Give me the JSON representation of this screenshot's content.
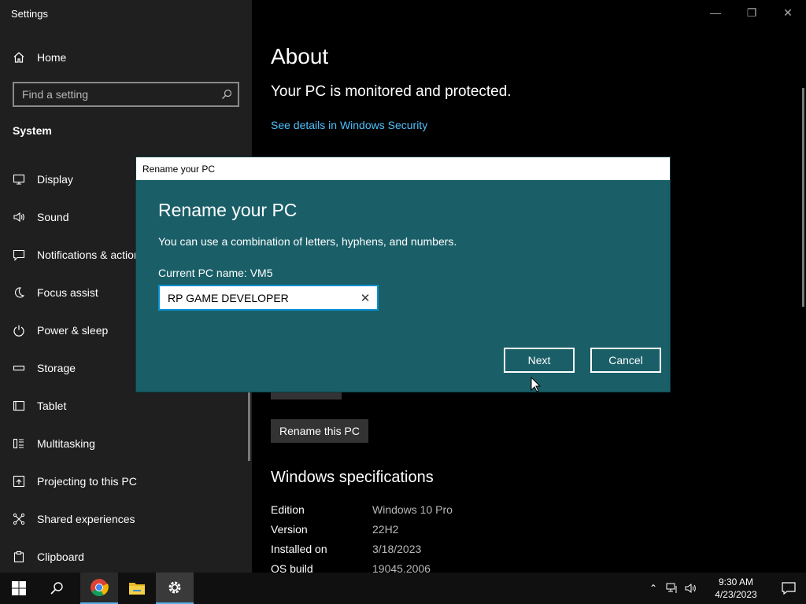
{
  "app": {
    "title": "Settings"
  },
  "sidebar": {
    "home_label": "Home",
    "search_placeholder": "Find a setting",
    "section_title": "System",
    "items": [
      {
        "label": "Display",
        "icon": "monitor-icon"
      },
      {
        "label": "Sound",
        "icon": "speaker-icon"
      },
      {
        "label": "Notifications & actions",
        "icon": "notification-icon"
      },
      {
        "label": "Focus assist",
        "icon": "moon-icon"
      },
      {
        "label": "Power & sleep",
        "icon": "power-icon"
      },
      {
        "label": "Storage",
        "icon": "storage-icon"
      },
      {
        "label": "Tablet",
        "icon": "tablet-icon"
      },
      {
        "label": "Multitasking",
        "icon": "multitasking-icon"
      },
      {
        "label": "Projecting to this PC",
        "icon": "projector-icon"
      },
      {
        "label": "Shared experiences",
        "icon": "shared-icon"
      },
      {
        "label": "Clipboard",
        "icon": "clipboard-icon"
      }
    ]
  },
  "main": {
    "title": "About",
    "protection_status": "Your PC is monitored and protected.",
    "security_link": "See details in Windows Security",
    "rename_button": "Rename this PC",
    "specs_title": "Windows specifications",
    "specs": [
      {
        "key": "Edition",
        "value": "Windows 10 Pro"
      },
      {
        "key": "Version",
        "value": "22H2"
      },
      {
        "key": "Installed on",
        "value": "3/18/2023"
      },
      {
        "key": "OS build",
        "value": "19045.2006"
      }
    ]
  },
  "dialog": {
    "window_title": "Rename your PC",
    "heading": "Rename your PC",
    "description": "You can use a combination of letters, hyphens, and numbers.",
    "current_name": "Current PC name: VM5",
    "input_value": "RP GAME DEVELOPER",
    "next_label": "Next",
    "cancel_label": "Cancel"
  },
  "taskbar": {
    "time": "9:30 AM",
    "date": "4/23/2023"
  },
  "colors": {
    "dialog_bg": "#1a5f68",
    "accent_link": "#4cc2ff",
    "input_focus": "#0a8fd0"
  }
}
